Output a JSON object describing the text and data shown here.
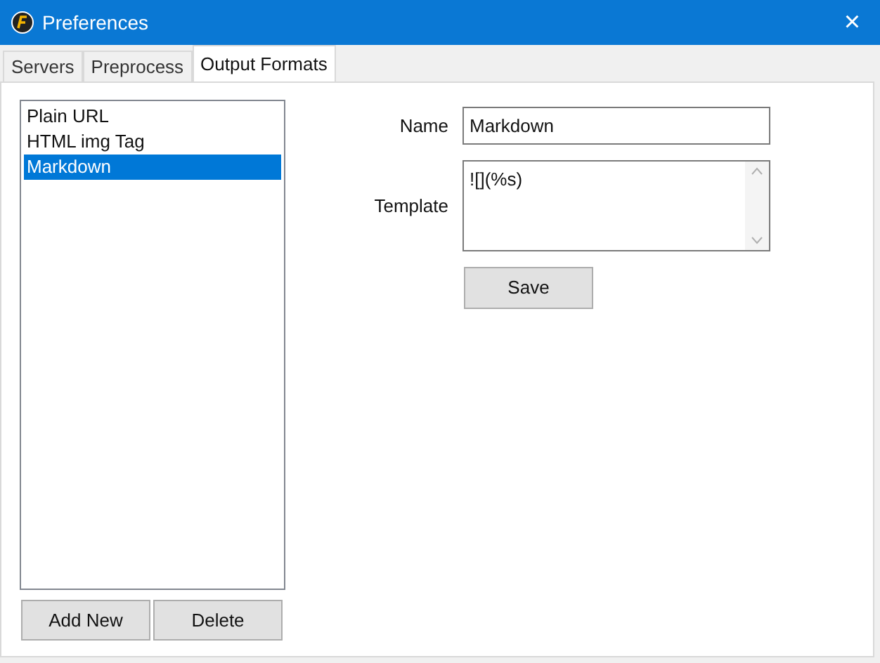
{
  "window": {
    "title": "Preferences",
    "close": "×"
  },
  "tabs": [
    {
      "label": "Servers",
      "selected": false
    },
    {
      "label": "Preprocess",
      "selected": false
    },
    {
      "label": "Output Formats",
      "selected": true
    }
  ],
  "formats": [
    {
      "label": "Plain URL",
      "selected": false
    },
    {
      "label": "HTML img Tag",
      "selected": false
    },
    {
      "label": "Markdown",
      "selected": true
    }
  ],
  "list_buttons": [
    "Add New",
    "Delete"
  ],
  "form": {
    "name_label": "Name",
    "name_value": "Markdown",
    "template_label": "Template",
    "template_value": "![](%s)",
    "save": "Save"
  }
}
